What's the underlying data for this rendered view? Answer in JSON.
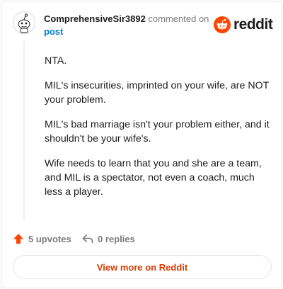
{
  "header": {
    "author": "ComprehensiveSir3892",
    "action_text": "commented on",
    "post_link": "post",
    "brand": "reddit",
    "avatar_icon": "snoo-avatar-icon",
    "brand_icon": "reddit-logo-icon"
  },
  "comment": {
    "paragraphs": [
      "NTA.",
      "MIL's insecurities, imprinted on your wife, are NOT your problem.",
      "MIL's bad marriage isn't your problem either, and it shouldn't be your wife's.",
      "Wife needs to learn that you and she are a team, and MIL is a spectator, not even a coach, much less a player."
    ]
  },
  "footer": {
    "upvotes": "5 upvotes",
    "replies": "0 replies",
    "upvote_icon": "upvote-arrow-icon",
    "reply_icon": "reply-arrow-icon"
  },
  "button": {
    "label": "View more on Reddit"
  },
  "colors": {
    "brand_orange": "#ff4500",
    "link_blue": "#0079d3",
    "button_text": "#d93a00",
    "muted": "#7c7c7c"
  }
}
